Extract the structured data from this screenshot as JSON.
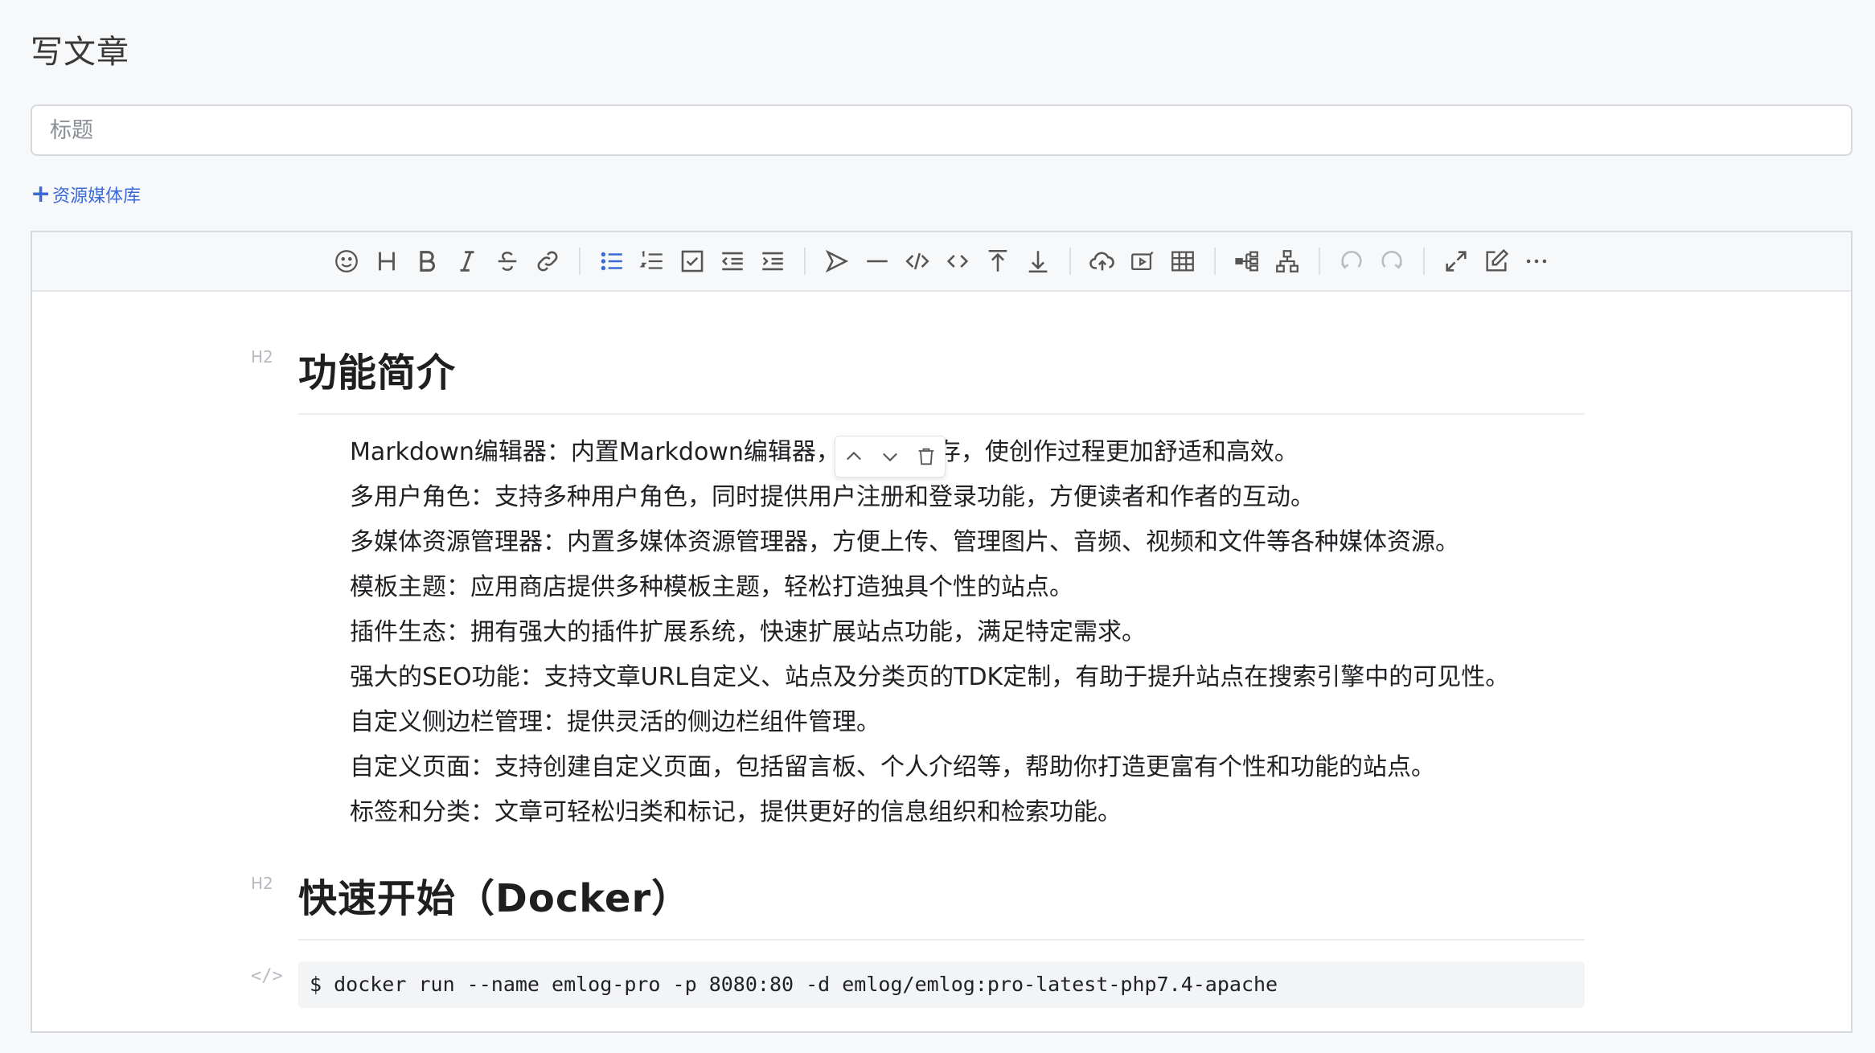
{
  "page": {
    "title": "写文章"
  },
  "title_field": {
    "placeholder": "标题",
    "value": ""
  },
  "media_link": {
    "plus": "+",
    "label": "资源媒体库"
  },
  "toolbar": {
    "groups": [
      [
        "emoji-icon",
        "heading-icon",
        "bold-icon",
        "italic-icon",
        "strikethrough-icon",
        "link-icon"
      ],
      [
        "bulleted-list-icon",
        "numbered-list-icon",
        "checklist-icon",
        "outdent-icon",
        "indent-icon"
      ],
      [
        "quote-icon",
        "horizontal-rule-icon",
        "code-block-icon",
        "inline-code-icon",
        "insert-before-icon",
        "insert-after-icon"
      ],
      [
        "upload-icon",
        "record-icon",
        "table-icon"
      ],
      [
        "outline-icon",
        "mindmap-icon"
      ],
      [
        "undo-icon",
        "redo-icon"
      ],
      [
        "fullscreen-icon",
        "edit-mode-icon",
        "more-icon"
      ]
    ]
  },
  "content": {
    "heading_marker": "H2",
    "code_marker": "</>",
    "section1": {
      "heading": "功能简介",
      "items": [
        "Markdown编辑器：内置Markdown编辑器，并自动保存，使创作过程更加舒适和高效。",
        "多用户角色：支持多种用户角色，同时提供用户注册和登录功能，方便读者和作者的互动。",
        "多媒体资源管理器：内置多媒体资源管理器，方便上传、管理图片、音频、视频和文件等各种媒体资源。",
        "模板主题：应用商店提供多种模板主题，轻松打造独具个性的站点。",
        "插件生态：拥有强大的插件扩展系统，快速扩展站点功能，满足特定需求。",
        "强大的SEO功能：支持文章URL自定义、站点及分类页的TDK定制，有助于提升站点在搜索引擎中的可见性。",
        "自定义侧边栏管理：提供灵活的侧边栏组件管理。",
        "自定义页面：支持创建自定义页面，包括留言板、个人介绍等，帮助你打造更富有个性和功能的站点。",
        "标签和分类：文章可轻松归类和标记，提供更好的信息组织和检索功能。"
      ]
    },
    "section2": {
      "heading": "快速开始（Docker）",
      "code": "$ docker run --name emlog-pro -p 8080:80 -d emlog/emlog:pro-latest-php7.4-apache"
    }
  },
  "colors": {
    "accent": "#3b6ad8",
    "icon": "#555555",
    "icon_disabled": "#b9bdc3",
    "active_icon": "#3b6ad8"
  }
}
